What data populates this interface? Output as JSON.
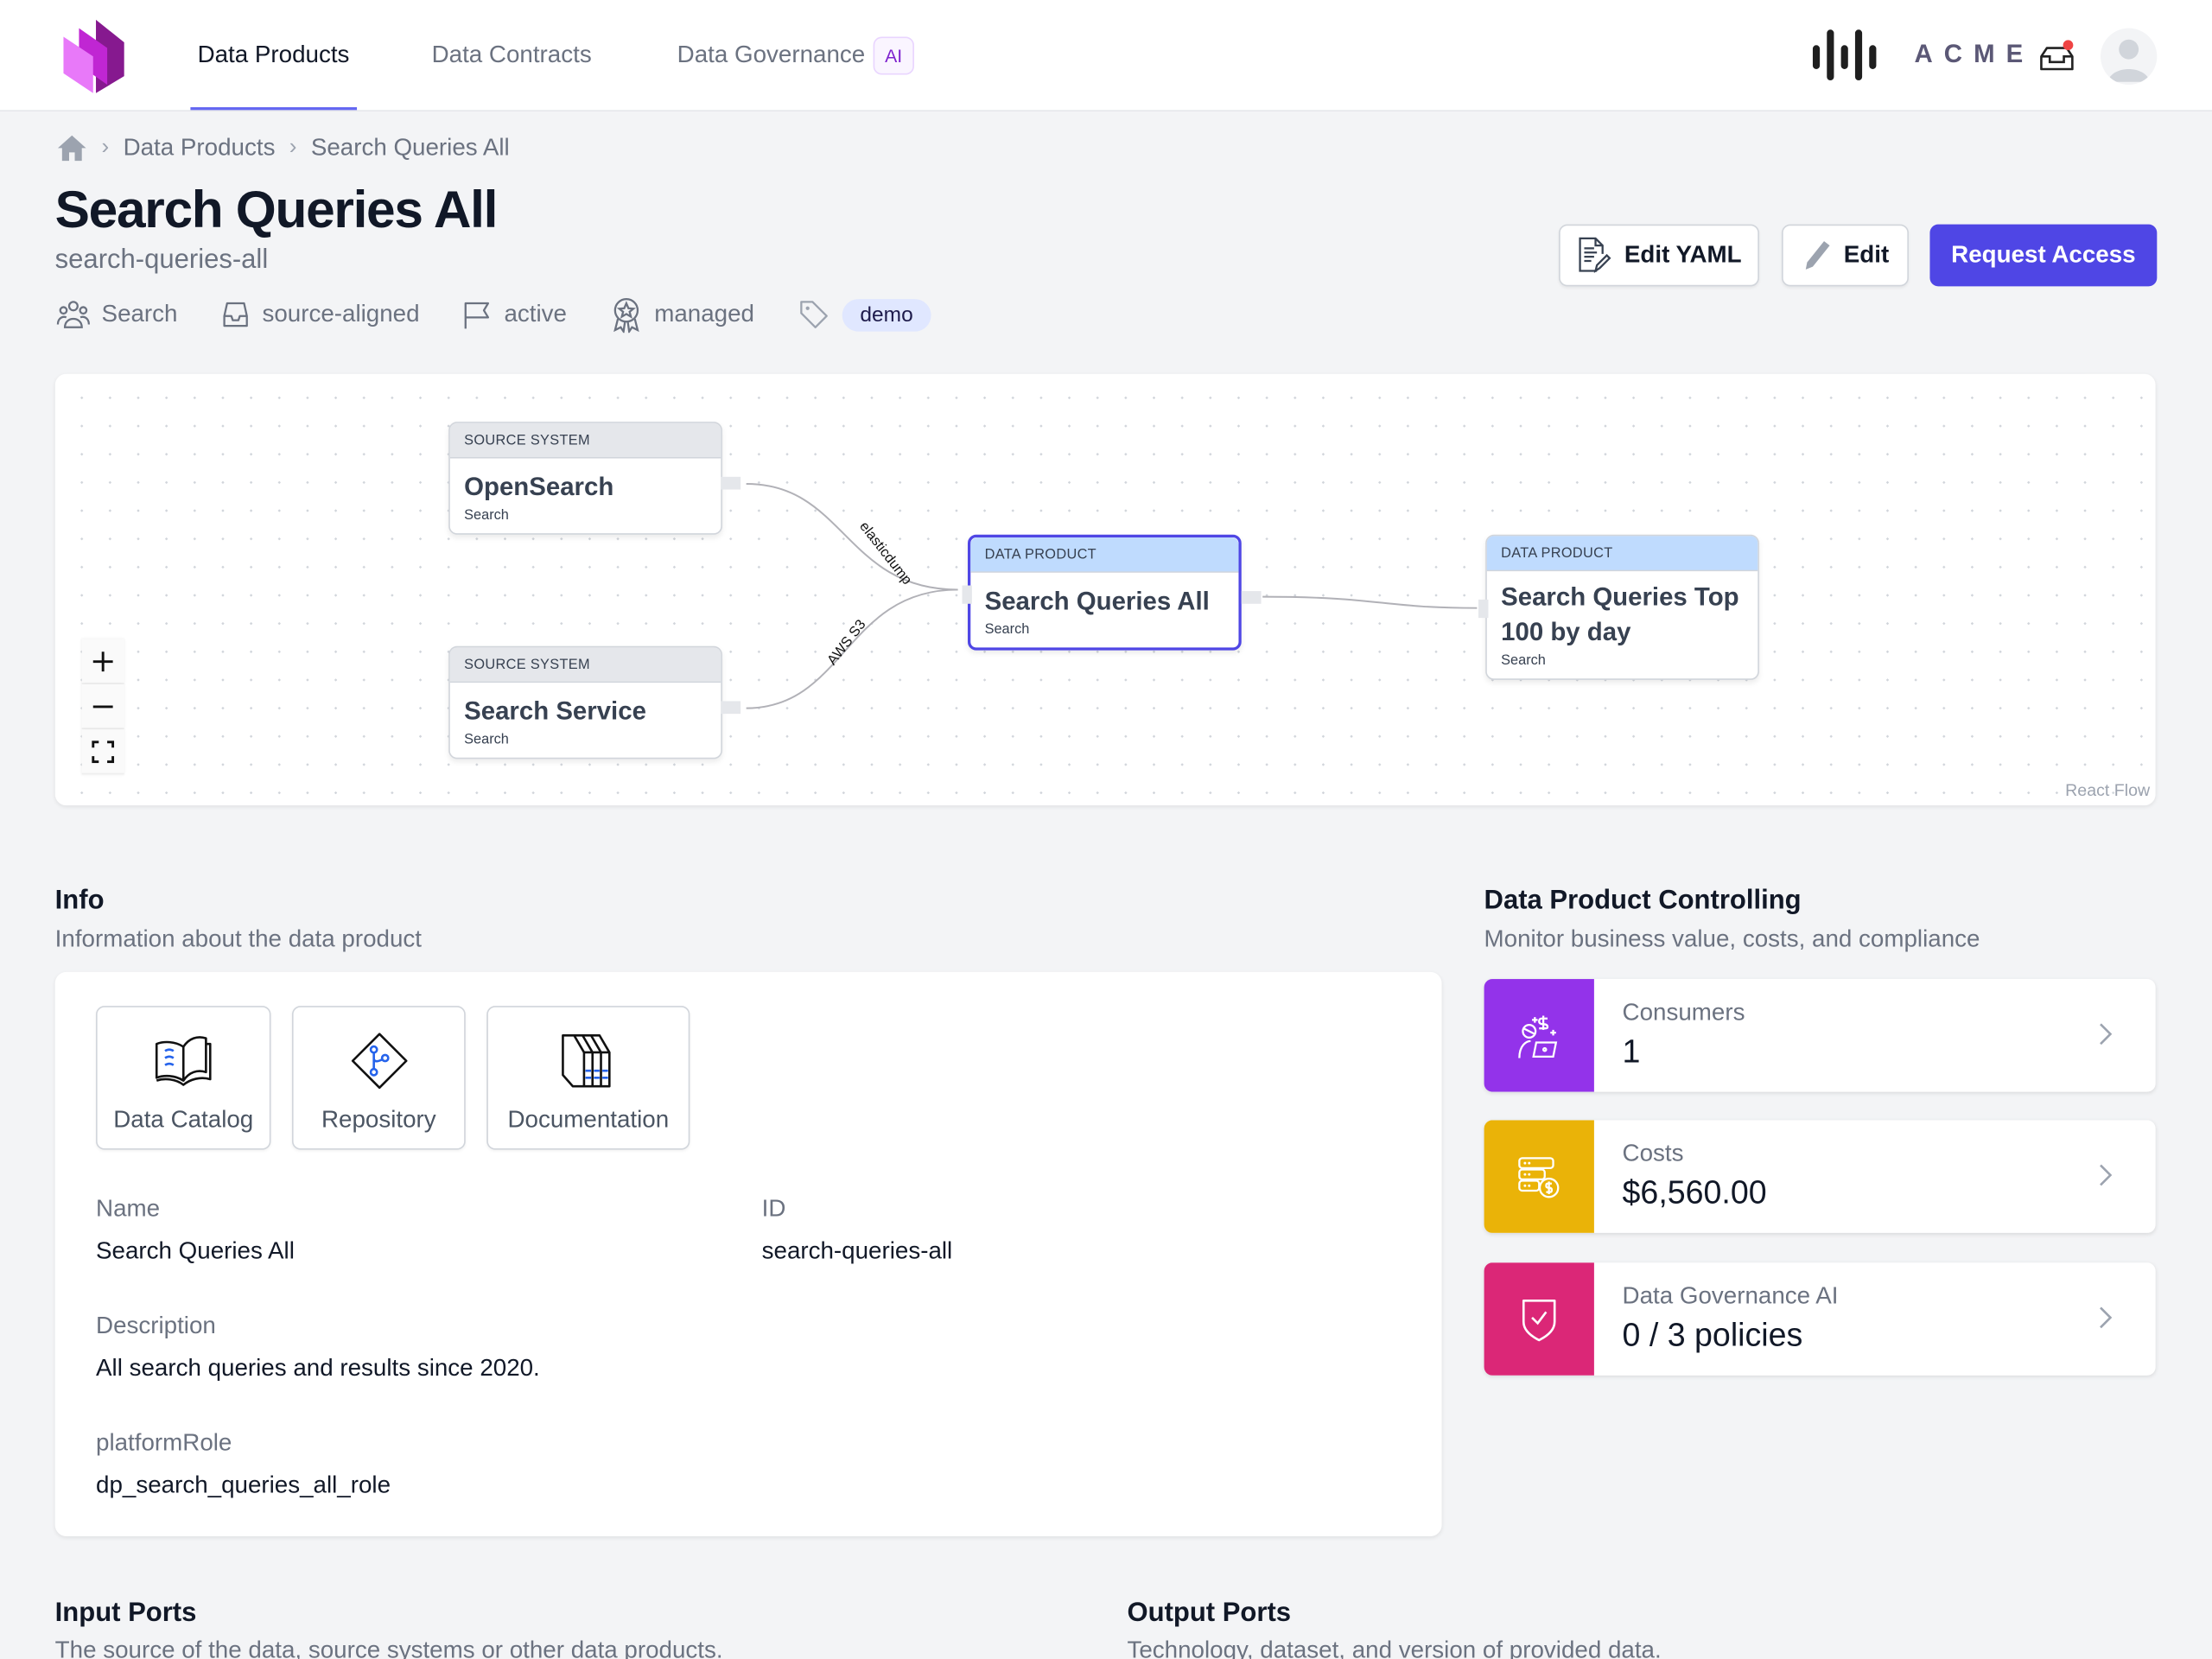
{
  "nav": {
    "tabs": [
      {
        "label": "Data Products",
        "active": true
      },
      {
        "label": "Data Contracts",
        "active": false
      },
      {
        "label": "Data Governance",
        "active": false,
        "badge": "AI"
      }
    ],
    "brand": "ACME",
    "icons": {
      "logo": "stacked-pages-logo",
      "org_logo": "sound-bars-logo",
      "inbox": "inbox-icon",
      "avatar": "user-avatar"
    },
    "accent": "#6366f1"
  },
  "breadcrumb": {
    "home_icon": "home-icon",
    "items": [
      "Data Products",
      "Search Queries All"
    ]
  },
  "header": {
    "title": "Search Queries All",
    "id": "search-queries-all",
    "meta": {
      "team": "Search",
      "type": "source-aligned",
      "status": "active",
      "management": "managed",
      "tags": [
        "demo"
      ]
    },
    "buttons": {
      "edit_yaml": "Edit YAML",
      "edit": "Edit",
      "request_access": "Request Access"
    },
    "primary_color": "#4f46e5"
  },
  "lineage": {
    "nodes": [
      {
        "kind": "SOURCE SYSTEM",
        "name": "OpenSearch",
        "domain": "Search"
      },
      {
        "kind": "SOURCE SYSTEM",
        "name": "Search Service",
        "domain": "Search"
      },
      {
        "kind": "DATA PRODUCT",
        "name": "Search Queries All",
        "domain": "Search",
        "selected": true
      },
      {
        "kind": "DATA PRODUCT",
        "name": "Search Queries Top 100 by day",
        "domain": "Search"
      }
    ],
    "edges": [
      {
        "from": "OpenSearch",
        "to": "Search Queries All",
        "label": "elasticdump"
      },
      {
        "from": "Search Service",
        "to": "Search Queries All",
        "label": "AWS S3"
      },
      {
        "from": "Search Queries All",
        "to": "Search Queries Top 100 by day",
        "label": ""
      }
    ],
    "controls": {
      "zoom_in": "+",
      "zoom_out": "−",
      "fit": "fit-view"
    },
    "attribution": "React Flow"
  },
  "info": {
    "heading": "Info",
    "description": "Information about the data product",
    "links": [
      {
        "label": "Data Catalog",
        "icon": "book-icon"
      },
      {
        "label": "Repository",
        "icon": "git-branch-icon"
      },
      {
        "label": "Documentation",
        "icon": "books-icon"
      }
    ],
    "fields": {
      "name_label": "Name",
      "name_value": "Search Queries All",
      "id_label": "ID",
      "id_value": "search-queries-all",
      "description_label": "Description",
      "description_value": "All search queries and results since 2020.",
      "platform_role_label": "platformRole",
      "platform_role_value": "dp_search_queries_all_role"
    }
  },
  "controlling": {
    "heading": "Data Product Controlling",
    "description": "Monitor business value, costs, and compliance",
    "items": [
      {
        "label": "Consumers",
        "value": "1",
        "color": "#9333ea",
        "icon": "consumer-money-icon"
      },
      {
        "label": "Costs",
        "value": "$6,560.00",
        "color": "#eab308",
        "icon": "server-cost-icon"
      },
      {
        "label": "Data Governance AI",
        "value": "0 / 3 policies",
        "color": "#db2777",
        "icon": "shield-check-icon"
      }
    ]
  },
  "ports": {
    "input_heading": "Input Ports",
    "input_description": "The source of the data, source systems or other data products.",
    "output_heading": "Output Ports",
    "output_description": "Technology, dataset, and version of provided data."
  }
}
